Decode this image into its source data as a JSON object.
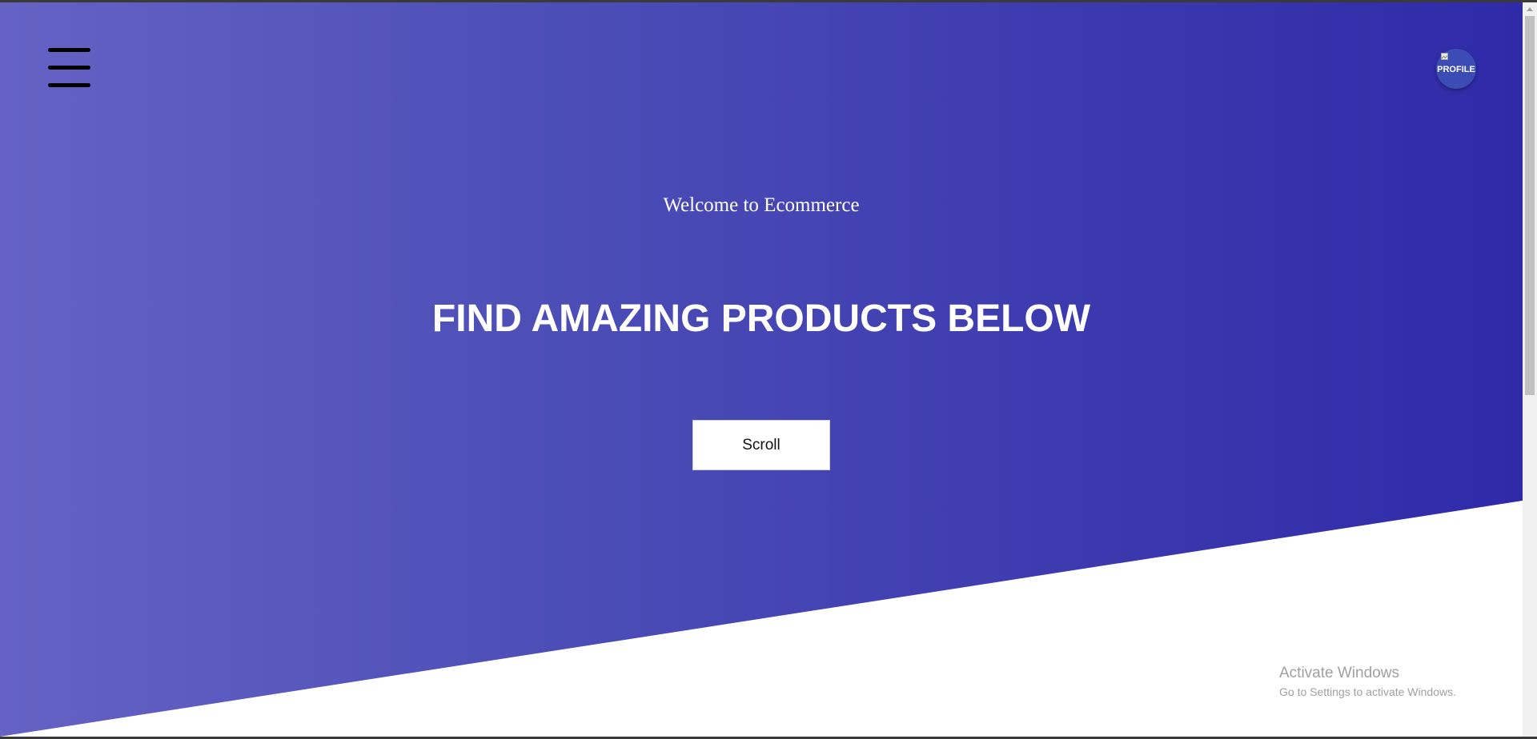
{
  "hero": {
    "welcome_text": "Welcome to Ecommerce",
    "headline": "FIND AMAZING PRODUCTS BELOW",
    "scroll_button_label": "Scroll",
    "gradient_start": "#6562c4",
    "gradient_end": "#2f2aa8"
  },
  "header": {
    "menu_icon": "hamburger-menu-icon",
    "profile_label": "PROFILE",
    "profile_icon": "broken-image-icon"
  },
  "watermark": {
    "title": "Activate Windows",
    "subtitle": "Go to Settings to activate Windows."
  }
}
